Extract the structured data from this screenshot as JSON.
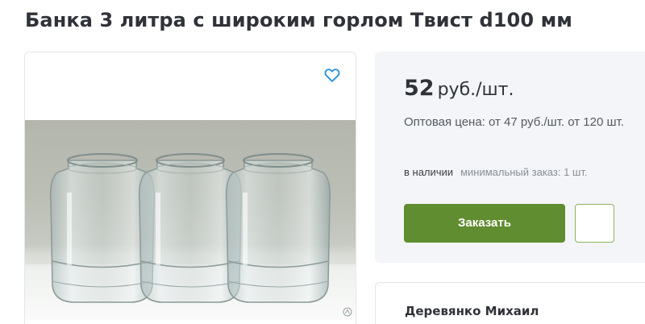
{
  "product": {
    "title": "Банка 3 литра с широким горлом Твист d100 мм",
    "image_alt": "Три стеклянные банки"
  },
  "icons": {
    "favorite": "heart-outline-icon",
    "photo_watermark": "watermark-icon"
  },
  "price": {
    "value": "52",
    "unit": "руб./шт.",
    "wholesale": "Оптовая цена: от 47 руб./шт. от 120 шт.",
    "stock": "в наличии",
    "min_order": "минимальный заказ: 1 шт."
  },
  "actions": {
    "order_label": "Заказать"
  },
  "seller": {
    "name": "Деревянко Михаил"
  },
  "colors": {
    "accent_green": "#5f8d2f",
    "heart_blue": "#2c8fd6",
    "card_bg": "#f3f5f8"
  }
}
